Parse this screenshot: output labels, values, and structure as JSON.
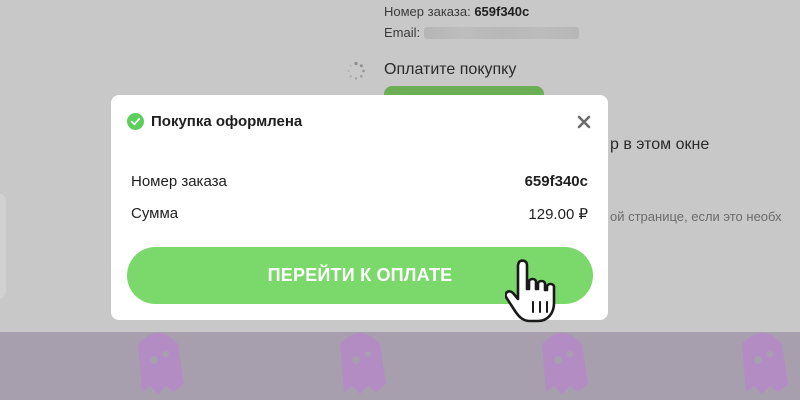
{
  "background": {
    "order_label": "Номер заказа:",
    "order_value": "659f340c",
    "email_label": "Email:",
    "pay_prompt": "Оплатите покупку",
    "window_text": "р в этом окне",
    "page_text": "ой странице, если это необх"
  },
  "modal": {
    "title": "Покупка оформлена",
    "close_icon": "close-icon",
    "success_icon": "check-circle-icon",
    "rows": [
      {
        "label": "Номер заказа",
        "value": "659f340c"
      },
      {
        "label": "Сумма",
        "value": "129.00 ₽"
      }
    ],
    "pay_button_label": "ПЕРЕЙТИ К ОПЛАТЕ"
  },
  "colors": {
    "accent_green": "#7bd86a",
    "check_green": "#5bd05c",
    "overlay": "#c8c8c9",
    "footer": "#a89fae"
  }
}
